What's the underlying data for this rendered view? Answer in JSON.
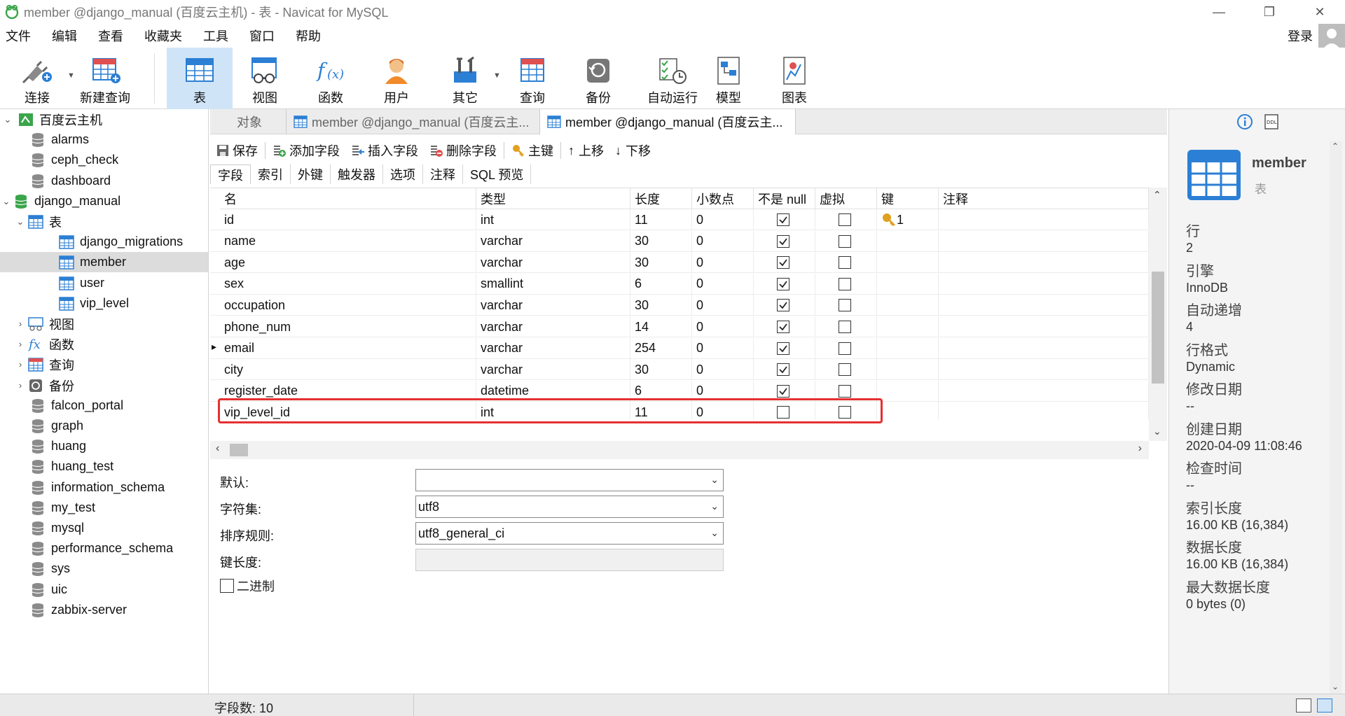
{
  "window": {
    "title": "member @django_manual (百度云主机) - 表 - Navicat for MySQL",
    "minimize_label": "—",
    "restore_label": "❐",
    "close_label": "✕"
  },
  "menu": {
    "items": [
      "文件",
      "编辑",
      "查看",
      "收藏夹",
      "工具",
      "窗口",
      "帮助"
    ],
    "login_label": "登录"
  },
  "toolbar": {
    "buttons": [
      {
        "label": "连接",
        "icon": "connect-icon"
      },
      {
        "label": "新建查询",
        "icon": "new-query-icon"
      },
      {
        "label": "表",
        "icon": "table-icon",
        "active": true
      },
      {
        "label": "视图",
        "icon": "view-icon"
      },
      {
        "label": "函数",
        "icon": "function-icon"
      },
      {
        "label": "用户",
        "icon": "user-icon"
      },
      {
        "label": "其它",
        "icon": "tools-icon"
      },
      {
        "label": "查询",
        "icon": "query-icon"
      },
      {
        "label": "备份",
        "icon": "backup-icon"
      },
      {
        "label": "自动运行",
        "icon": "schedule-icon"
      },
      {
        "label": "模型",
        "icon": "model-icon"
      },
      {
        "label": "图表",
        "icon": "chart-icon"
      }
    ]
  },
  "tree": {
    "connection": "百度云主机",
    "items": [
      {
        "label": "alarms",
        "type": "db"
      },
      {
        "label": "ceph_check",
        "type": "db"
      },
      {
        "label": "dashboard",
        "type": "db"
      },
      {
        "label": "django_manual",
        "type": "db-open"
      },
      {
        "label": "表",
        "type": "folder-tables"
      },
      {
        "label": "django_migrations",
        "type": "table"
      },
      {
        "label": "member",
        "type": "table",
        "selected": true
      },
      {
        "label": "user",
        "type": "table"
      },
      {
        "label": "vip_level",
        "type": "table"
      },
      {
        "label": "视图",
        "type": "folder-views"
      },
      {
        "label": "函数",
        "type": "folder-functions"
      },
      {
        "label": "查询",
        "type": "folder-queries"
      },
      {
        "label": "备份",
        "type": "folder-backups"
      },
      {
        "label": "falcon_portal",
        "type": "db"
      },
      {
        "label": "graph",
        "type": "db"
      },
      {
        "label": "huang",
        "type": "db"
      },
      {
        "label": "huang_test",
        "type": "db"
      },
      {
        "label": "information_schema",
        "type": "db"
      },
      {
        "label": "my_test",
        "type": "db"
      },
      {
        "label": "mysql",
        "type": "db"
      },
      {
        "label": "performance_schema",
        "type": "db"
      },
      {
        "label": "sys",
        "type": "db"
      },
      {
        "label": "uic",
        "type": "db"
      },
      {
        "label": "zabbix-server",
        "type": "db"
      }
    ]
  },
  "tabs": [
    "对象",
    "member @django_manual (百度云主...",
    "member @django_manual (百度云主..."
  ],
  "design_toolbar": [
    "保存",
    "添加字段",
    "插入字段",
    "删除字段",
    "主键",
    "上移",
    "下移"
  ],
  "subtabs": [
    "字段",
    "索引",
    "外键",
    "触发器",
    "选项",
    "注释",
    "SQL 预览"
  ],
  "grid": {
    "headers": [
      "名",
      "类型",
      "长度",
      "小数点",
      "不是 null",
      "虚拟",
      "键",
      "注释"
    ],
    "rows": [
      {
        "name": "id",
        "type": "int",
        "length": "11",
        "decimals": "0",
        "not_null": true,
        "virtual": false,
        "key": "1"
      },
      {
        "name": "name",
        "type": "varchar",
        "length": "30",
        "decimals": "0",
        "not_null": true,
        "virtual": false,
        "key": ""
      },
      {
        "name": "age",
        "type": "varchar",
        "length": "30",
        "decimals": "0",
        "not_null": true,
        "virtual": false,
        "key": ""
      },
      {
        "name": "sex",
        "type": "smallint",
        "length": "6",
        "decimals": "0",
        "not_null": true,
        "virtual": false,
        "key": ""
      },
      {
        "name": "occupation",
        "type": "varchar",
        "length": "30",
        "decimals": "0",
        "not_null": true,
        "virtual": false,
        "key": ""
      },
      {
        "name": "phone_num",
        "type": "varchar",
        "length": "14",
        "decimals": "0",
        "not_null": true,
        "virtual": false,
        "key": ""
      },
      {
        "name": "email",
        "type": "varchar",
        "length": "254",
        "decimals": "0",
        "not_null": true,
        "virtual": false,
        "key": "",
        "current": true
      },
      {
        "name": "city",
        "type": "varchar",
        "length": "30",
        "decimals": "0",
        "not_null": true,
        "virtual": false,
        "key": ""
      },
      {
        "name": "register_date",
        "type": "datetime",
        "length": "6",
        "decimals": "0",
        "not_null": true,
        "virtual": false,
        "key": ""
      },
      {
        "name": "vip_level_id",
        "type": "int",
        "length": "11",
        "decimals": "0",
        "not_null": false,
        "virtual": false,
        "key": ""
      }
    ]
  },
  "properties": {
    "default_label": "默认:",
    "default_value": "",
    "charset_label": "字符集:",
    "charset_value": "utf8",
    "collation_label": "排序规则:",
    "collation_value": "utf8_general_ci",
    "key_length_label": "键长度:",
    "binary_label": "二进制"
  },
  "info": {
    "name": "member",
    "kind": "表",
    "fields": [
      {
        "label": "行",
        "value": "2"
      },
      {
        "label": "引擎",
        "value": "InnoDB"
      },
      {
        "label": "自动递增",
        "value": "4"
      },
      {
        "label": "行格式",
        "value": "Dynamic"
      },
      {
        "label": "修改日期",
        "value": "--"
      },
      {
        "label": "创建日期",
        "value": "2020-04-09 11:08:46"
      },
      {
        "label": "检查时间",
        "value": "--"
      },
      {
        "label": "索引长度",
        "value": "16.00 KB (16,384)"
      },
      {
        "label": "数据长度",
        "value": "16.00 KB (16,384)"
      },
      {
        "label": "最大数据长度",
        "value": "0 bytes (0)"
      }
    ]
  },
  "status": {
    "field_count": "字段数: 10"
  },
  "colors": {
    "accent": "#2b7fd4",
    "active_toolbar": "#cfe4f7",
    "highlight": "#e53030",
    "key_gold": "#e0a020"
  }
}
